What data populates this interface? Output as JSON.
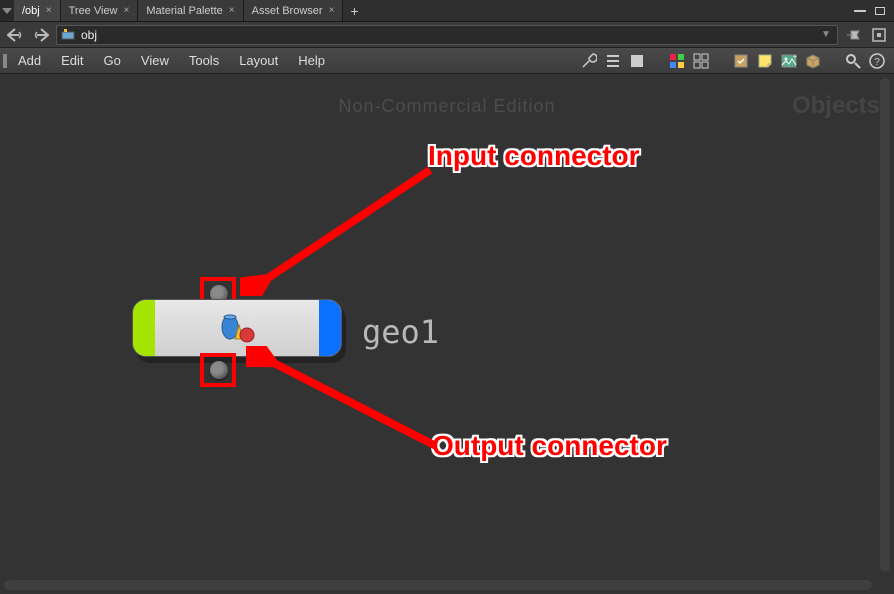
{
  "tabs": [
    {
      "label": "/obj",
      "active": true
    },
    {
      "label": "Tree View",
      "active": false
    },
    {
      "label": "Material Palette",
      "active": false
    },
    {
      "label": "Asset Browser",
      "active": false
    }
  ],
  "path": {
    "value": "obj"
  },
  "menus": [
    "Add",
    "Edit",
    "Go",
    "View",
    "Tools",
    "Layout",
    "Help"
  ],
  "watermark": {
    "center": "Non-Commercial Edition",
    "right": "Objects"
  },
  "node": {
    "label": "geo1"
  },
  "annotations": {
    "input": "Input connector",
    "output": "Output connector"
  }
}
